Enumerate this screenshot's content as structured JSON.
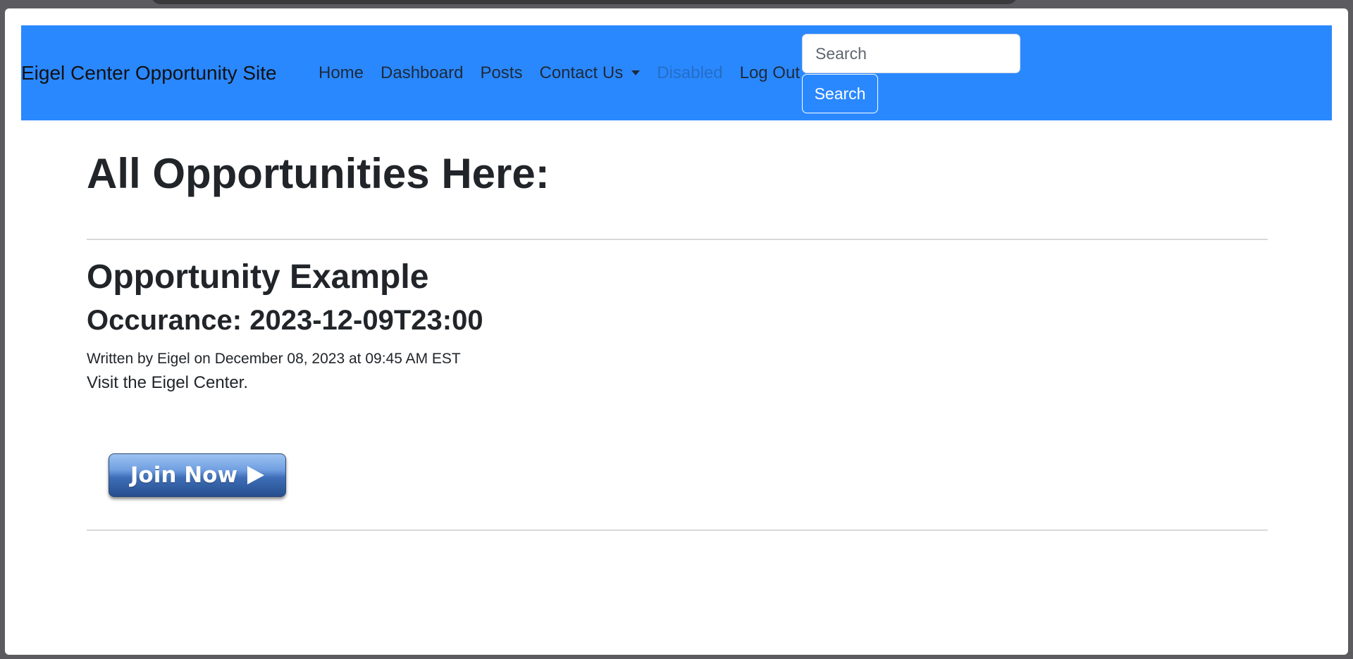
{
  "navbar": {
    "brand": "Eigel Center Opportunity Site",
    "links": [
      {
        "label": "Home"
      },
      {
        "label": "Dashboard"
      },
      {
        "label": "Posts"
      },
      {
        "label": "Contact Us"
      },
      {
        "label": "Disabled"
      },
      {
        "label": "Log Out"
      }
    ],
    "search_placeholder": "Search",
    "search_button": "Search",
    "background_color": "#2a88ff"
  },
  "main": {
    "heading": "All Opportunities Here:",
    "posts": [
      {
        "title": "Opportunity Example",
        "occurrence": "Occurance: 2023-12-09T23:00",
        "meta": "Written by Eigel on December 08, 2023 at 09:45 AM EST",
        "body": "Visit the Eigel Center.",
        "join_label": "Join Now"
      }
    ]
  },
  "icons": {
    "dropdown": "chevron-down-icon",
    "join_arrow": "play-arrow-icon"
  }
}
